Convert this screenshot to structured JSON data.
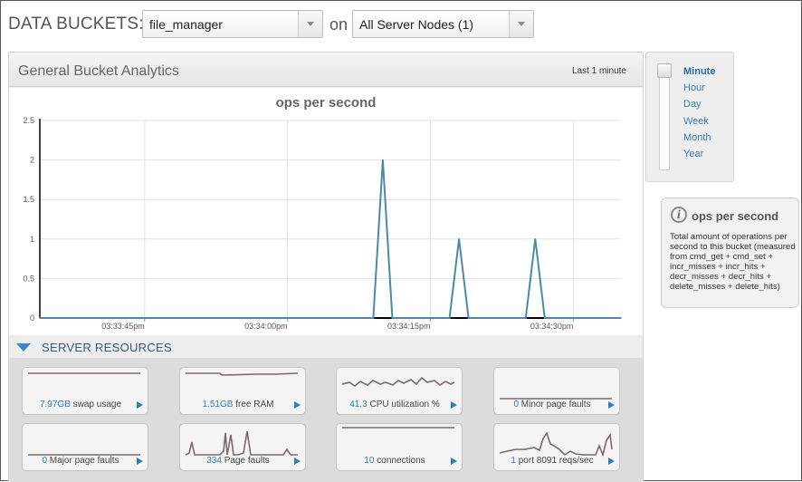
{
  "header": {
    "label": "DATA BUCKETS:",
    "bucket_select": "file_manager",
    "on_label": "on",
    "nodes_select": "All Server Nodes (1)"
  },
  "analytics": {
    "title": "General Bucket Analytics",
    "range": "Last 1 minute"
  },
  "zoom": {
    "options": [
      "Minute",
      "Hour",
      "Day",
      "Week",
      "Month",
      "Year"
    ],
    "selected": "Minute"
  },
  "info": {
    "title": "ops per second",
    "text": "Total amount of operations per second to this bucket (measured from cmd_get + cmd_set + incr_misses + incr_hits + decr_misses + decr_hits + delete_misses + delete_hits)"
  },
  "server_resources": {
    "label": "SERVER RESOURCES",
    "tiles": [
      {
        "value": "7.97GB",
        "label": "swap usage"
      },
      {
        "value": "1.51GB",
        "label": "free RAM"
      },
      {
        "value": "41.3",
        "label": "CPU utilization %"
      },
      {
        "value": "0",
        "label": "Minor page faults"
      },
      {
        "value": "0",
        "label": "Major page faults"
      },
      {
        "value": "334",
        "label": "Page faults"
      },
      {
        "value": "10",
        "label": "connections"
      },
      {
        "value": "1",
        "label": "port 8091 reqs/sec"
      }
    ]
  },
  "colors": {
    "series": "#4a8aa6",
    "baseline": "#000000",
    "link": "#3b7ab0",
    "sparkline": "#7a6a6a"
  },
  "chart_data": {
    "type": "line",
    "title": "ops per second",
    "xlabel": "",
    "ylabel": "",
    "ylim": [
      0,
      2.5
    ],
    "yticks": [
      "2.5",
      "2",
      "1.5",
      "1",
      "0.5",
      "0"
    ],
    "xticks": [
      "03:33:45pm",
      "03:34:00pm",
      "03:34:15pm",
      "03:34:30pm"
    ],
    "xrange_seconds": [
      0,
      61
    ],
    "grid": true,
    "series": [
      {
        "points": [
          [
            0,
            0
          ],
          [
            35,
            0
          ],
          [
            36,
            2
          ],
          [
            37,
            0
          ],
          [
            43,
            0
          ],
          [
            44,
            1
          ],
          [
            45,
            0
          ],
          [
            51,
            0
          ],
          [
            52,
            1
          ],
          [
            53,
            0
          ],
          [
            61,
            0
          ]
        ]
      }
    ]
  }
}
